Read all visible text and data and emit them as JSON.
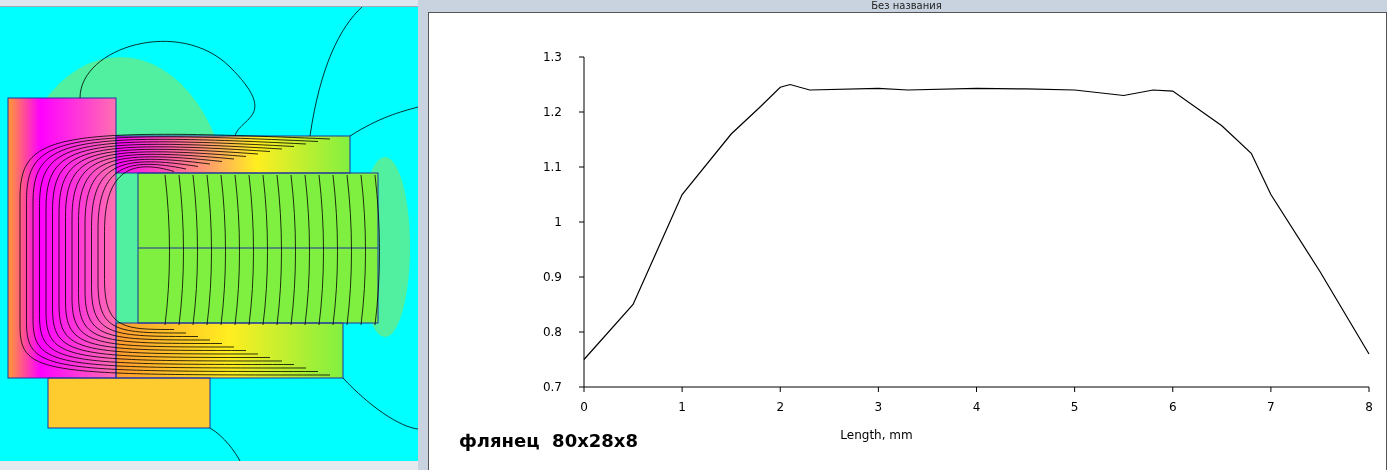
{
  "plot_window": {
    "title": "Без названия",
    "caption": "флянец  80x28x8",
    "chart_data": {
      "type": "line",
      "xlabel": "Length, mm",
      "xlim": [
        0,
        8
      ],
      "ylim": [
        0.7,
        1.3
      ],
      "xticks": [
        0,
        1,
        2,
        3,
        4,
        5,
        6,
        7,
        8
      ],
      "yticks": [
        0.7,
        0.8,
        0.9,
        1,
        1.1,
        1.2,
        1.3
      ],
      "x": [
        0,
        0.5,
        1,
        1.5,
        1.8,
        2,
        2.1,
        2.3,
        3,
        3.3,
        4,
        4.5,
        5,
        5.5,
        5.8,
        6,
        6.5,
        6.8,
        7,
        7.5,
        8
      ],
      "series": [
        {
          "color": "#000000",
          "values": [
            0.75,
            0.85,
            1.05,
            1.16,
            1.21,
            1.245,
            1.25,
            1.24,
            1.243,
            1.24,
            1.243,
            1.242,
            1.24,
            1.23,
            1.24,
            1.238,
            1.175,
            1.125,
            1.05,
            0.91,
            0.76
          ]
        }
      ]
    }
  }
}
